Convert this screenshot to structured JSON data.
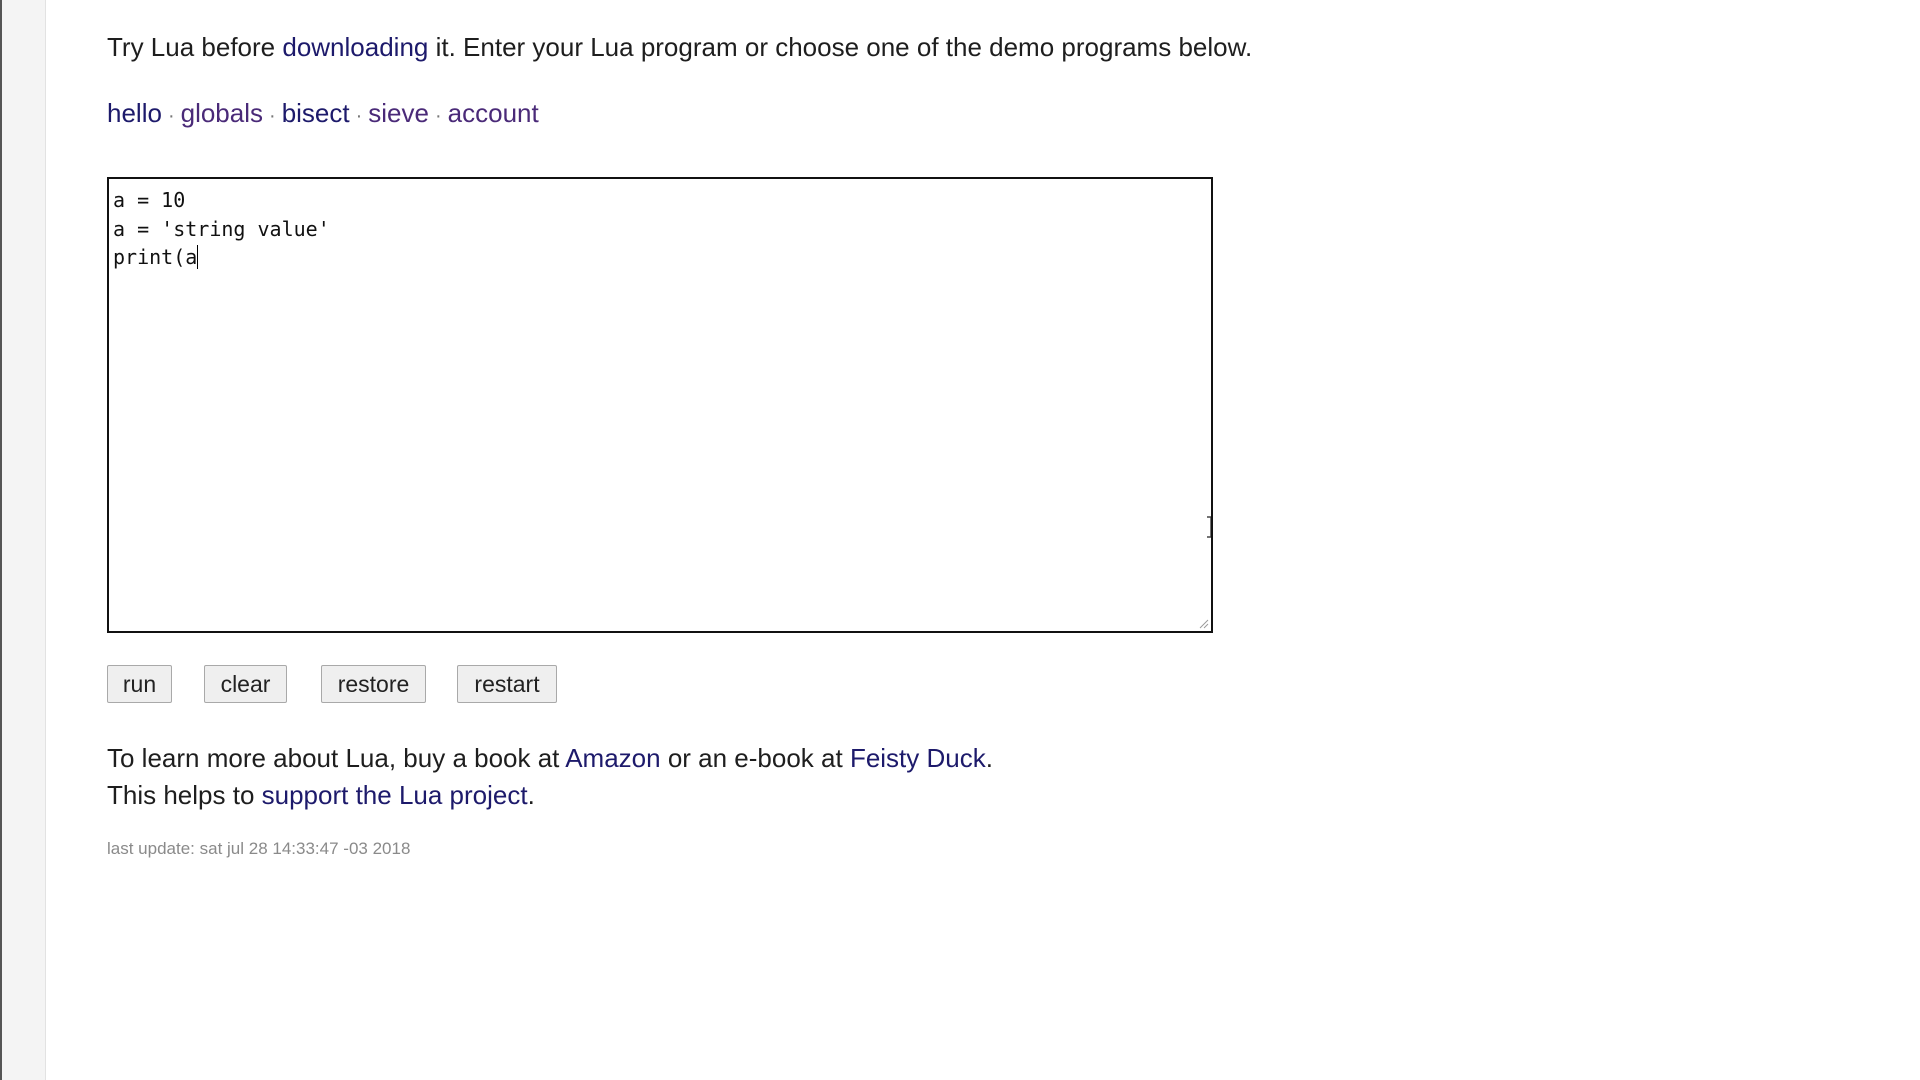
{
  "intro": {
    "before_link": "Try Lua before ",
    "link": "downloading",
    "after_link": " it. Enter your Lua program or choose one of the demo programs below."
  },
  "demos": {
    "separator": "·",
    "items": [
      {
        "label": "hello",
        "visited": false
      },
      {
        "label": "globals",
        "visited": true
      },
      {
        "label": "bisect",
        "visited": false
      },
      {
        "label": "sieve",
        "visited": true
      },
      {
        "label": "account",
        "visited": true
      }
    ]
  },
  "editor": {
    "lines": [
      "a = 10",
      "a = 'string value'",
      "print(a"
    ]
  },
  "buttons": {
    "run": "run",
    "clear": "clear",
    "restore": "restore",
    "restart": "restart"
  },
  "learn_more": {
    "line1_a": "To learn more about Lua, buy a book at ",
    "amazon": "Amazon",
    "line1_b": " or an e-book at ",
    "feisty_duck": "Feisty Duck",
    "line1_c": ".",
    "line2_a": "This helps to ",
    "support": "support the Lua project",
    "line2_b": "."
  },
  "last_update": "last update: sat jul 28 14:33:47 -03 2018",
  "colors": {
    "link": "#1d1a6b",
    "visited_link": "#4a2a78",
    "text": "#1e1e1e",
    "muted": "#8a8a8a",
    "button_bg": "#efefef"
  }
}
